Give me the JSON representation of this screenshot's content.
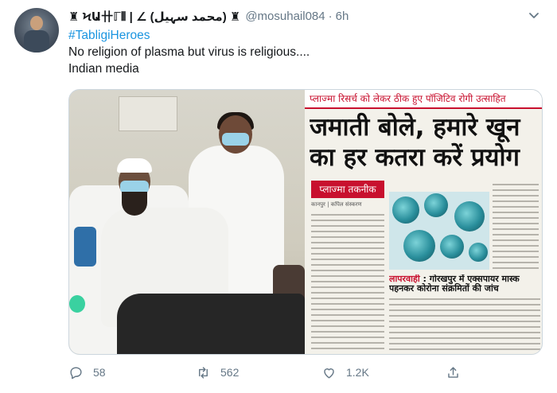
{
  "tweet": {
    "display_name": "♜ ϞԱ卄ℾ⦀ | ∠ (محمد سہیل) ♜",
    "handle": "@mosuhail084",
    "separator": "·",
    "time": "6h",
    "hashtag": "#TabligiHeroes",
    "line1": "No religion of plasma but virus is religious....",
    "line2": "Indian media"
  },
  "newspaper": {
    "top_strip": "प्लाज्मा रिसर्च को लेकर ठीक हुए पॉजिटिव रोगी उत्साहित",
    "headline_1": "जमाती बोले, हमारे खून",
    "headline_2": "का हर कतरा करें प्रयोग",
    "section_tag": "प्लाज्मा तकनीक",
    "byline": "कानपुर | कपिल संस्करण",
    "sub_tag": "लापरवाही",
    "sub_headline": " : गोरखपुर में एक्सपायर मास्क पहनकर कोरोना संक्रमितों की जांच"
  },
  "actions": {
    "reply_count": "58",
    "retweet_count": "562",
    "like_count": "1.2K"
  },
  "colors": {
    "hashtag": "#1b95e0",
    "muted": "#657786",
    "text": "#14171a",
    "newspaper_red": "#c8102e"
  },
  "icons": {
    "reply": "reply-icon",
    "retweet": "retweet-icon",
    "like": "heart-icon",
    "share": "share-icon",
    "more": "chevron-down-icon"
  }
}
